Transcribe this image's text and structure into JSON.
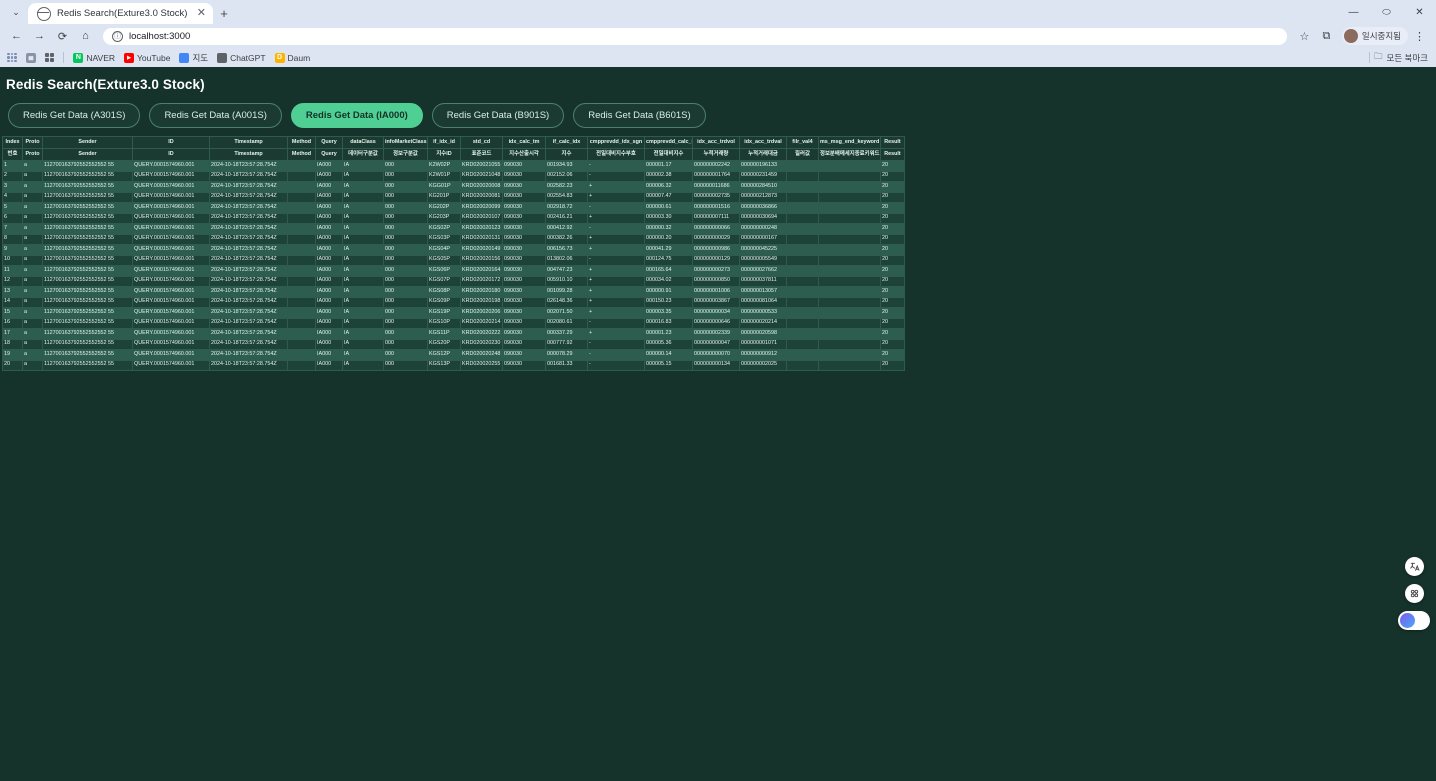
{
  "browser": {
    "tab_title": "Redis Search(Exture3.0 Stock)",
    "tab_close_glyph": "✕",
    "newtab_glyph": "+",
    "chevron_glyph": "⌄",
    "window_minimize": "—",
    "window_maximize": "⬭",
    "window_close": "✕",
    "nav": {
      "back": "←",
      "forward": "→",
      "reload": "⟳",
      "home": "⌂",
      "url": "localhost:3000",
      "info_glyph": "ⓘ",
      "star_glyph": "☆",
      "extensions_glyph": "⧉",
      "menu_glyph": "⋮",
      "profile_label": "일시중지됨"
    },
    "bookmarks": [
      {
        "label": "NAVER",
        "icon": "naver-icon",
        "letter": "N",
        "color": "#03c75a"
      },
      {
        "label": "YouTube",
        "icon": "youtube-icon",
        "letter": "▶",
        "color": "#ff0000"
      },
      {
        "label": "지도",
        "icon": "map-icon",
        "letter": "",
        "color": "#4285f4"
      },
      {
        "label": "ChatGPT",
        "icon": "chatgpt-icon",
        "letter": "◉",
        "color": "#6e6e80"
      },
      {
        "label": "Daum",
        "icon": "daum-icon",
        "letter": "D",
        "color": "#ffb300"
      }
    ],
    "all_bookmarks_label": "모든 북마크",
    "folder_glyph": "🗀"
  },
  "page": {
    "title": "Redis Search(Exture3.0 Stock)",
    "tabs": [
      {
        "label": "Redis Get Data (A301S)",
        "active": false
      },
      {
        "label": "Redis Get Data (A001S)",
        "active": false
      },
      {
        "label": "Redis Get Data (IA000)",
        "active": true
      },
      {
        "label": "Redis Get Data (B901S)",
        "active": false
      },
      {
        "label": "Redis Get Data (B601S)",
        "active": false
      }
    ]
  },
  "float_buttons": [
    {
      "name": "translate-icon",
      "glyph": "文A"
    },
    {
      "name": "qr-grid-icon",
      "glyph": "▩"
    },
    {
      "name": "assistant-avatar-icon",
      "glyph": ""
    }
  ],
  "table": {
    "headers_en": [
      "Index",
      "Proto",
      "Sender",
      "ID",
      "Timestamp",
      "Method",
      "Query",
      "dataClass",
      "infoMarketClass",
      "if_idx_id",
      "std_cd",
      "idx_calc_tm",
      "if_calc_idx",
      "cmpprevdd_idx_sgn",
      "cmpprevdd_calc_idx",
      "idx_acc_trdvol",
      "idx_acc_trdval",
      "filr_val4",
      "ms_msg_end_keyword",
      "Result"
    ],
    "headers_kr": [
      "번호",
      "Proto",
      "Sender",
      "ID",
      "Timestamp",
      "Method",
      "Query",
      "데이터구분값",
      "정보구분값",
      "지수ID",
      "표준코드",
      "지수산출시각",
      "지수",
      "전일대비지수부호",
      "전일대비지수",
      "누적거래량",
      "누적거래대금",
      "필러값",
      "정보분배메세지종료키워드",
      "Result"
    ],
    "rows": [
      {
        "index": "1",
        "proto": "a",
        "sender": "112700163792552552552 55",
        "id": "QUERY.0001574960.001",
        "timestamp": "2024-10-18T23:57:28.754Z",
        "method": "",
        "query": "IA000",
        "dataClass": "IA",
        "infoMarketClass": "000",
        "if_idx_id": "K2W02P",
        "std_cd": "KRD020021055",
        "idx_calc_tm": "090030",
        "if_calc_idx": "001934.93",
        "sgn": "-",
        "calc_idx": "000001.17",
        "trdvol": "000000002242",
        "trdval": "000000196133",
        "filr": "",
        "keyword": "",
        "result": "20"
      },
      {
        "index": "2",
        "proto": "a",
        "sender": "112700163792552552552 55",
        "id": "QUERY.0001574960.001",
        "timestamp": "2024-10-18T23:57:28.754Z",
        "method": "",
        "query": "IA000",
        "dataClass": "IA",
        "infoMarketClass": "000",
        "if_idx_id": "K2W01P",
        "std_cd": "KRD020021048",
        "idx_calc_tm": "090030",
        "if_calc_idx": "002152.06",
        "sgn": "-",
        "calc_idx": "000002.38",
        "trdvol": "000000001764",
        "trdval": "000000231459",
        "filr": "",
        "keyword": "",
        "result": "20"
      },
      {
        "index": "3",
        "proto": "a",
        "sender": "112700163792552552552 55",
        "id": "QUERY.0001574960.001",
        "timestamp": "2024-10-18T23:57:28.754Z",
        "method": "",
        "query": "IA000",
        "dataClass": "IA",
        "infoMarketClass": "000",
        "if_idx_id": "KGG01P",
        "std_cd": "KRD020020008",
        "idx_calc_tm": "090030",
        "if_calc_idx": "002582.23",
        "sgn": "+",
        "calc_idx": "000006.32",
        "trdvol": "000000011686",
        "trdval": "000000284510",
        "filr": "",
        "keyword": "",
        "result": "20"
      },
      {
        "index": "4",
        "proto": "a",
        "sender": "112700163792552552552 55",
        "id": "QUERY.0001574960.001",
        "timestamp": "2024-10-18T23:57:28.754Z",
        "method": "",
        "query": "IA000",
        "dataClass": "IA",
        "infoMarketClass": "000",
        "if_idx_id": "KG201P",
        "std_cd": "KRD020020081",
        "idx_calc_tm": "090030",
        "if_calc_idx": "002554.83",
        "sgn": "+",
        "calc_idx": "000007.47",
        "trdvol": "000000002735",
        "trdval": "000000212873",
        "filr": "",
        "keyword": "",
        "result": "20"
      },
      {
        "index": "5",
        "proto": "a",
        "sender": "112700163792552552552 55",
        "id": "QUERY.0001574960.001",
        "timestamp": "2024-10-18T23:57:28.754Z",
        "method": "",
        "query": "IA000",
        "dataClass": "IA",
        "infoMarketClass": "000",
        "if_idx_id": "KG202P",
        "std_cd": "KRD020020099",
        "idx_calc_tm": "090030",
        "if_calc_idx": "002918.72",
        "sgn": "-",
        "calc_idx": "000000.61",
        "trdvol": "000000001516",
        "trdval": "000000036866",
        "filr": "",
        "keyword": "",
        "result": "20"
      },
      {
        "index": "6",
        "proto": "a",
        "sender": "112700163792552552552 55",
        "id": "QUERY.0001574960.001",
        "timestamp": "2024-10-18T23:57:28.754Z",
        "method": "",
        "query": "IA000",
        "dataClass": "IA",
        "infoMarketClass": "000",
        "if_idx_id": "KG203P",
        "std_cd": "KRD020020107",
        "idx_calc_tm": "090030",
        "if_calc_idx": "002416.21",
        "sgn": "+",
        "calc_idx": "000003.30",
        "trdvol": "000000007111",
        "trdval": "000000030694",
        "filr": "",
        "keyword": "",
        "result": "20"
      },
      {
        "index": "7",
        "proto": "a",
        "sender": "112700163792552552552 55",
        "id": "QUERY.0001574960.001",
        "timestamp": "2024-10-18T23:57:28.754Z",
        "method": "",
        "query": "IA000",
        "dataClass": "IA",
        "infoMarketClass": "000",
        "if_idx_id": "KGS02P",
        "std_cd": "KRD020020123",
        "idx_calc_tm": "090030",
        "if_calc_idx": "000412.92",
        "sgn": "-",
        "calc_idx": "000000.32",
        "trdvol": "000000000066",
        "trdval": "000000000248",
        "filr": "",
        "keyword": "",
        "result": "20"
      },
      {
        "index": "8",
        "proto": "a",
        "sender": "112700163792552552552 55",
        "id": "QUERY.0001574960.001",
        "timestamp": "2024-10-18T23:57:28.754Z",
        "method": "",
        "query": "IA000",
        "dataClass": "IA",
        "infoMarketClass": "000",
        "if_idx_id": "KGS03P",
        "std_cd": "KRD020020131",
        "idx_calc_tm": "090030",
        "if_calc_idx": "000382.26",
        "sgn": "+",
        "calc_idx": "000000.20",
        "trdvol": "000000000029",
        "trdval": "000000000167",
        "filr": "",
        "keyword": "",
        "result": "20"
      },
      {
        "index": "9",
        "proto": "a",
        "sender": "112700163792552552552 55",
        "id": "QUERY.0001574960.001",
        "timestamp": "2024-10-18T23:57:28.754Z",
        "method": "",
        "query": "IA000",
        "dataClass": "IA",
        "infoMarketClass": "000",
        "if_idx_id": "KGS04P",
        "std_cd": "KRD020020149",
        "idx_calc_tm": "090030",
        "if_calc_idx": "006156.73",
        "sgn": "+",
        "calc_idx": "000041.29",
        "trdvol": "000000000986",
        "trdval": "000000045225",
        "filr": "",
        "keyword": "",
        "result": "20"
      },
      {
        "index": "10",
        "proto": "a",
        "sender": "112700163792552552552 55",
        "id": "QUERY.0001574960.001",
        "timestamp": "2024-10-18T23:57:28.754Z",
        "method": "",
        "query": "IA000",
        "dataClass": "IA",
        "infoMarketClass": "000",
        "if_idx_id": "KGS05P",
        "std_cd": "KRD020020156",
        "idx_calc_tm": "090030",
        "if_calc_idx": "013802.06",
        "sgn": "-",
        "calc_idx": "000124.75",
        "trdvol": "000000000129",
        "trdval": "000000005549",
        "filr": "",
        "keyword": "",
        "result": "20"
      },
      {
        "index": "11",
        "proto": "a",
        "sender": "112700163792552552552 55",
        "id": "QUERY.0001574960.001",
        "timestamp": "2024-10-18T23:57:28.754Z",
        "method": "",
        "query": "IA000",
        "dataClass": "IA",
        "infoMarketClass": "000",
        "if_idx_id": "KGS06P",
        "std_cd": "KRD020020164",
        "idx_calc_tm": "090030",
        "if_calc_idx": "004747.23",
        "sgn": "+",
        "calc_idx": "000165.64",
        "trdvol": "000000000273",
        "trdval": "000000027662",
        "filr": "",
        "keyword": "",
        "result": "20"
      },
      {
        "index": "12",
        "proto": "a",
        "sender": "112700163792552552552 55",
        "id": "QUERY.0001574960.001",
        "timestamp": "2024-10-18T23:57:28.754Z",
        "method": "",
        "query": "IA000",
        "dataClass": "IA",
        "infoMarketClass": "000",
        "if_idx_id": "KGS07P",
        "std_cd": "KRD020020172",
        "idx_calc_tm": "090030",
        "if_calc_idx": "005910.10",
        "sgn": "+",
        "calc_idx": "000034.02",
        "trdvol": "000000000850",
        "trdval": "000000037811",
        "filr": "",
        "keyword": "",
        "result": "20"
      },
      {
        "index": "13",
        "proto": "a",
        "sender": "112700163792552552552 55",
        "id": "QUERY.0001574960.001",
        "timestamp": "2024-10-18T23:57:28.754Z",
        "method": "",
        "query": "IA000",
        "dataClass": "IA",
        "infoMarketClass": "000",
        "if_idx_id": "KGS08P",
        "std_cd": "KRD020020180",
        "idx_calc_tm": "090030",
        "if_calc_idx": "001099.28",
        "sgn": "+",
        "calc_idx": "000000.91",
        "trdvol": "000000001006",
        "trdval": "000000013057",
        "filr": "",
        "keyword": "",
        "result": "20"
      },
      {
        "index": "14",
        "proto": "a",
        "sender": "112700163792552552552 55",
        "id": "QUERY.0001574960.001",
        "timestamp": "2024-10-18T23:57:28.754Z",
        "method": "",
        "query": "IA000",
        "dataClass": "IA",
        "infoMarketClass": "000",
        "if_idx_id": "KGS09P",
        "std_cd": "KRD020020198",
        "idx_calc_tm": "090030",
        "if_calc_idx": "026148.36",
        "sgn": "+",
        "calc_idx": "000150.23",
        "trdvol": "000000003867",
        "trdval": "000000081064",
        "filr": "",
        "keyword": "",
        "result": "20"
      },
      {
        "index": "15",
        "proto": "a",
        "sender": "112700163792552552552 55",
        "id": "QUERY.0001574960.001",
        "timestamp": "2024-10-18T23:57:28.754Z",
        "method": "",
        "query": "IA000",
        "dataClass": "IA",
        "infoMarketClass": "000",
        "if_idx_id": "KGS19P",
        "std_cd": "KRD020020206",
        "idx_calc_tm": "090030",
        "if_calc_idx": "002071.50",
        "sgn": "+",
        "calc_idx": "000003.35",
        "trdvol": "000000000034",
        "trdval": "000000000533",
        "filr": "",
        "keyword": "",
        "result": "20"
      },
      {
        "index": "16",
        "proto": "a",
        "sender": "112700163792552552552 55",
        "id": "QUERY.0001574960.001",
        "timestamp": "2024-10-18T23:57:28.754Z",
        "method": "",
        "query": "IA000",
        "dataClass": "IA",
        "infoMarketClass": "000",
        "if_idx_id": "KGS10P",
        "std_cd": "KRD020020214",
        "idx_calc_tm": "090030",
        "if_calc_idx": "002080.61",
        "sgn": "-",
        "calc_idx": "000016.83",
        "trdvol": "000000000646",
        "trdval": "000000020214",
        "filr": "",
        "keyword": "",
        "result": "20"
      },
      {
        "index": "17",
        "proto": "a",
        "sender": "112700163792552552552 55",
        "id": "QUERY.0001574960.001",
        "timestamp": "2024-10-18T23:57:28.754Z",
        "method": "",
        "query": "IA000",
        "dataClass": "IA",
        "infoMarketClass": "000",
        "if_idx_id": "KGS11P",
        "std_cd": "KRD020020222",
        "idx_calc_tm": "090030",
        "if_calc_idx": "000337.29",
        "sgn": "+",
        "calc_idx": "000001.23",
        "trdvol": "000000002339",
        "trdval": "000000020598",
        "filr": "",
        "keyword": "",
        "result": "20"
      },
      {
        "index": "18",
        "proto": "a",
        "sender": "112700163792552552552 55",
        "id": "QUERY.0001574960.001",
        "timestamp": "2024-10-18T23:57:28.754Z",
        "method": "",
        "query": "IA000",
        "dataClass": "IA",
        "infoMarketClass": "000",
        "if_idx_id": "KGS20P",
        "std_cd": "KRD020020230",
        "idx_calc_tm": "090030",
        "if_calc_idx": "000777.92",
        "sgn": "-",
        "calc_idx": "000005.36",
        "trdvol": "000000000047",
        "trdval": "000000001071",
        "filr": "",
        "keyword": "",
        "result": "20"
      },
      {
        "index": "19",
        "proto": "a",
        "sender": "112700163792552552552 55",
        "id": "QUERY.0001574960.001",
        "timestamp": "2024-10-18T23:57:28.754Z",
        "method": "",
        "query": "IA000",
        "dataClass": "IA",
        "infoMarketClass": "000",
        "if_idx_id": "KGS12P",
        "std_cd": "KRD020020248",
        "idx_calc_tm": "090030",
        "if_calc_idx": "000078.29",
        "sgn": "-",
        "calc_idx": "000000.14",
        "trdvol": "000000000070",
        "trdval": "000000000912",
        "filr": "",
        "keyword": "",
        "result": "20"
      },
      {
        "index": "20",
        "proto": "a",
        "sender": "112700163792552552552 55",
        "id": "QUERY.0001574960.001",
        "timestamp": "2024-10-18T23:57:28.754Z",
        "method": "",
        "query": "IA000",
        "dataClass": "IA",
        "infoMarketClass": "000",
        "if_idx_id": "KGS13P",
        "std_cd": "KRD020020255",
        "idx_calc_tm": "090030",
        "if_calc_idx": "001681.33",
        "sgn": "-",
        "calc_idx": "000005.15",
        "trdvol": "000000000134",
        "trdval": "000000002025",
        "filr": "",
        "keyword": "",
        "result": "20"
      }
    ]
  },
  "colors": {
    "page_bg": "#15332b",
    "accent": "#4fcf94",
    "row_odd": "#2c5d4e",
    "row_even": "#1d4237",
    "header_bg": "#1b3b32",
    "border": "#2f5b4d"
  }
}
